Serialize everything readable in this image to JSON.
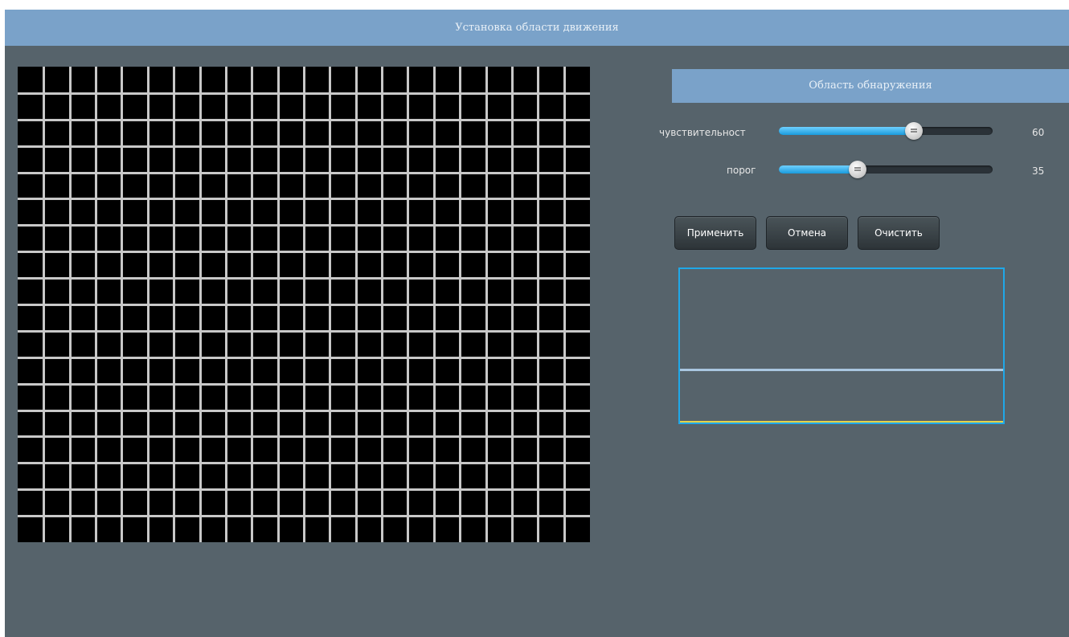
{
  "window": {
    "title": "Установка области движения"
  },
  "grid": {
    "columns": 22,
    "rows": 18
  },
  "panel": {
    "header": "Область обнаружения",
    "sliders": [
      {
        "label": "чувствительност",
        "value": "60",
        "level": 0.63
      },
      {
        "label": "порог",
        "value": "35",
        "level": 0.37
      }
    ],
    "buttons": {
      "apply": "Применить",
      "cancel": "Отмена",
      "clear": "Очистить"
    }
  },
  "colors": {
    "background": "#56636b",
    "header": "#7aa2c9",
    "accent": "#1fa8e8",
    "grid_line": "#c8c8c8",
    "grid_cell": "#000000"
  }
}
